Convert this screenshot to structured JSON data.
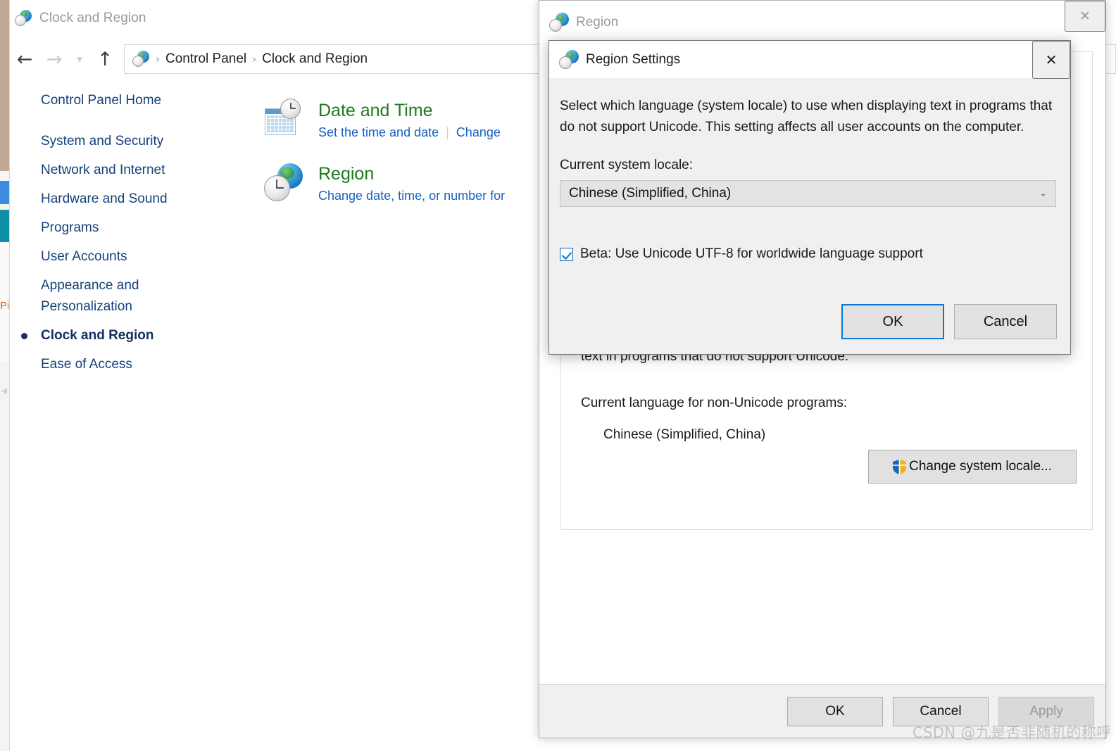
{
  "control_panel": {
    "window_title": "Clock and Region",
    "window_icon": "globe-clock-icon",
    "nav": {
      "back_icon": "arrow-left-icon",
      "forward_icon": "arrow-right-icon",
      "recent_icon": "chevron-down-icon",
      "up_icon": "arrow-up-icon"
    },
    "breadcrumb": {
      "icon": "globe-clock-icon",
      "separator": "›",
      "crumbs": [
        "Control Panel",
        "Clock and Region"
      ]
    },
    "sidebar": {
      "home_label": "Control Panel Home",
      "items": [
        {
          "label": "System and Security",
          "current": false
        },
        {
          "label": "Network and Internet",
          "current": false
        },
        {
          "label": "Hardware and Sound",
          "current": false
        },
        {
          "label": "Programs",
          "current": false
        },
        {
          "label": "User Accounts",
          "current": false
        },
        {
          "label": "Appearance and Personalization",
          "current": false
        },
        {
          "label": "Clock and Region",
          "current": true
        },
        {
          "label": "Ease of Access",
          "current": false
        }
      ]
    },
    "main": {
      "items": [
        {
          "icon": "calendar-clock-icon",
          "title": "Date and Time",
          "links": [
            "Set the time and date",
            "Change"
          ],
          "divider": "|"
        },
        {
          "icon": "globe-clock-icon",
          "title": "Region",
          "links": [
            "Change date, time, or number for"
          ],
          "divider": ""
        }
      ]
    }
  },
  "region_window": {
    "title": "Region",
    "icon": "globe-clock-icon",
    "close_icon": "close-icon",
    "clipped_description": "text in programs that do not support Unicode.",
    "current_language_label": "Current language for non-Unicode programs:",
    "current_language_value": "Chinese (Simplified, China)",
    "change_locale_button": {
      "label": "Change system locale...",
      "icon": "uac-shield-icon"
    },
    "footer_buttons": [
      {
        "label": "OK",
        "disabled": false
      },
      {
        "label": "Cancel",
        "disabled": false
      },
      {
        "label": "Apply",
        "disabled": true
      }
    ]
  },
  "dialog": {
    "title": "Region Settings",
    "icon": "globe-clock-icon",
    "close_icon": "close-icon",
    "description": "Select which language (system locale) to use when displaying text in programs that do not support Unicode. This setting affects all user accounts on the computer.",
    "locale_label": "Current system locale:",
    "locale_value": "Chinese (Simplified, China)",
    "locale_arrow": "⌄",
    "checkbox": {
      "label": "Beta: Use Unicode UTF-8 for worldwide language support",
      "checked": true
    },
    "buttons": [
      {
        "label": "OK",
        "default": true
      },
      {
        "label": "Cancel",
        "default": false
      }
    ]
  },
  "watermark": {
    "text": "CSDN @九是否非随机的称呼"
  },
  "colors": {
    "accent_blue": "#0a78d4",
    "link_blue": "#1560c2",
    "sidebar_blue": "#14417a",
    "heading_green": "#1e7a1e",
    "dialog_bg": "#f0f0f0",
    "button_face": "#e1e1e1"
  }
}
